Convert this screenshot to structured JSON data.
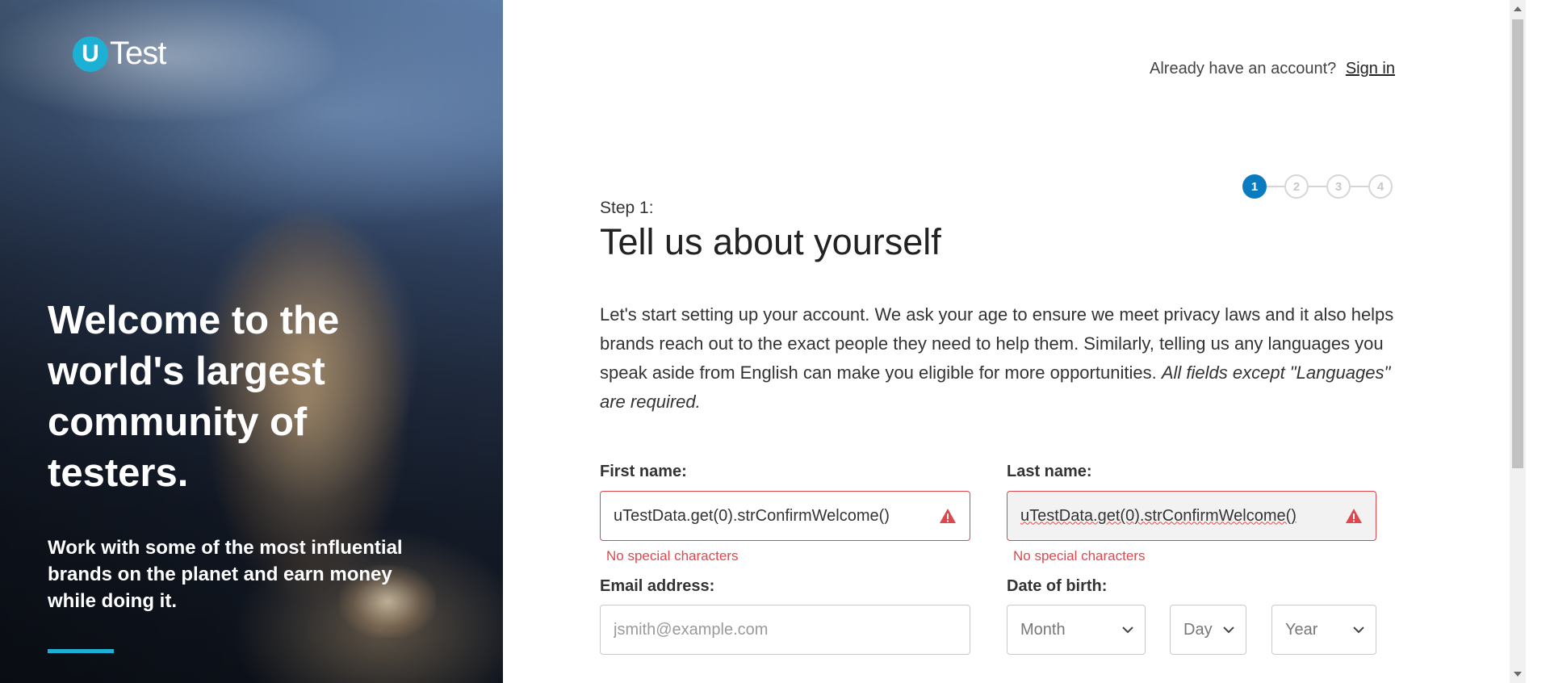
{
  "brand": {
    "logo_letter": "U",
    "logo_text": "Test",
    "accent_color": "#1cb1d4"
  },
  "hero": {
    "title": "Welcome to the world's largest community of testers.",
    "subtitle": "Work with some of the most influential brands on the planet and earn money while doing it."
  },
  "header": {
    "prompt": "Already have an account?",
    "signin_label": "Sign in"
  },
  "stepper": {
    "steps": [
      "1",
      "2",
      "3",
      "4"
    ],
    "active_step": 1,
    "active_color": "#0a7bc0"
  },
  "form": {
    "step_label": "Step 1:",
    "title": "Tell us about yourself",
    "intro": "Let's start setting up your account. We ask your age to ensure we meet privacy laws and it also helps brands reach out to the exact people they need to help them. Similarly, telling us any languages you speak aside from English can make you eligible for more opportunities.",
    "intro_note": "All fields except \"Languages\" are required.",
    "first_name": {
      "label": "First name:",
      "value": "uTestData.get(0).strConfirmWelcome()",
      "error": "No special characters"
    },
    "last_name": {
      "label": "Last name:",
      "value": "uTestData.get(0).strConfirmWelcome()",
      "error": "No special characters"
    },
    "email": {
      "label": "Email address:",
      "placeholder": "jsmith@example.com",
      "value": ""
    },
    "dob": {
      "label": "Date of birth:",
      "month": "Month",
      "day": "Day",
      "year": "Year"
    },
    "error_color": "#e0474c"
  },
  "icons": [
    "warning-icon",
    "chevron-down-icon"
  ]
}
